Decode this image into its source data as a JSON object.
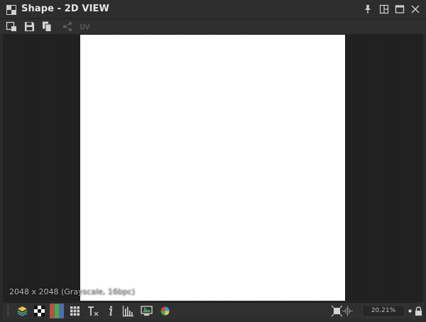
{
  "window": {
    "title": "Shape - 2D VIEW"
  },
  "viewport": {
    "image_info": "2048 x 2048 (Grayscale, 16bpc)"
  },
  "statusbar": {
    "zoom": "20.21%"
  },
  "icons": {
    "app": "app-window-icon",
    "pin": "pin-icon",
    "dock": "dock-icon",
    "maximize": "maximize-icon",
    "close": "close-icon",
    "toolbar": [
      "view-options-icon",
      "save-icon",
      "copy-icon",
      "share-icon",
      "uv-icon"
    ],
    "status": [
      "layers-icon",
      "checker-icon",
      "channels-icon",
      "grid-icon",
      "tiling-icon",
      "info-icon",
      "histogram-icon",
      "display-icon",
      "color-icon",
      "fit-view-icon",
      "pan-icon",
      "zoom-dot-icon",
      "lock-icon"
    ]
  },
  "colors": {
    "background": "#2b2b2b",
    "viewport": "#1f1f1f",
    "canvas": "#ffffff"
  }
}
